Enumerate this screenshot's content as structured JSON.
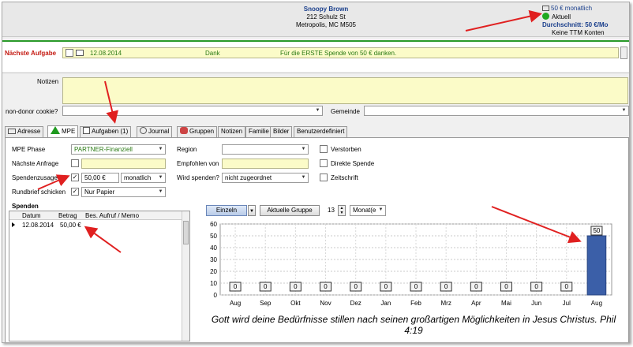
{
  "contact": {
    "name": "Snoopy Brown",
    "street": "212 Schulz St",
    "city": "Metropolis, MC  M505"
  },
  "status": {
    "monthly": "50 € monatlich",
    "current": "Aktuell",
    "average": "Durchschnitt: 50 €/Mo",
    "ttm": "Keine TTM Konten"
  },
  "task": {
    "label": "Nächste Aufgabe",
    "date": "12.08.2014",
    "type": "Dank",
    "description": "Für die ERSTE Spende von 50 € danken."
  },
  "notes_label": "Notizen",
  "cookie_label": "non-donor cookie?",
  "gemeinde_label": "Gemeinde",
  "tabs": [
    "Adresse",
    "MPE",
    "Aufgaben (1)",
    "Journal",
    "Gruppen",
    "Notizen",
    "Familie",
    "Bilder",
    "Benutzerdefiniert"
  ],
  "form": {
    "mpe_phase_label": "MPE Phase",
    "mpe_phase_value": "PARTNER-Finanziell",
    "next_request_label": "Nächste Anfrage",
    "pledge_label": "Spendenzusage",
    "pledge_amount": "50,00 €",
    "pledge_freq": "monatlich",
    "newsletter_label": "Rundbrief schicken",
    "newsletter_value": "Nur Papier",
    "region_label": "Region",
    "referred_label": "Empfohlen von",
    "will_give_label": "Wird spenden?",
    "will_give_value": "nicht zugeordnet",
    "deceased_label": "Verstorben",
    "direct_label": "Direkte Spende",
    "magazine_label": "Zeitschrift"
  },
  "gifts": {
    "title": "Spenden",
    "columns": [
      "Datum",
      "Betrag",
      "Bes. Aufruf / Memo"
    ],
    "rows": [
      {
        "date": "12.08.2014",
        "amount": "50,00 €"
      }
    ]
  },
  "chart_controls": {
    "single": "Einzeln",
    "group": "Aktuelle Gruppe",
    "count": "13",
    "period": "Monat(e"
  },
  "chart_data": {
    "type": "bar",
    "categories": [
      "Aug",
      "Sep",
      "Okt",
      "Nov",
      "Dez",
      "Jan",
      "Feb",
      "Mrz",
      "Apr",
      "Mai",
      "Jun",
      "Jul",
      "Aug"
    ],
    "values": [
      0,
      0,
      0,
      0,
      0,
      0,
      0,
      0,
      0,
      0,
      0,
      0,
      50
    ],
    "ylim": [
      0,
      60
    ],
    "yticks": [
      0,
      10,
      20,
      30,
      40,
      50,
      60
    ],
    "grid": true,
    "bar_color": "#3b5fa8"
  },
  "verse": "Gott wird deine Bedürfnisse stillen nach seinen großartigen Möglichkeiten in Jesus Christus.  Phil 4:19",
  "colors": {
    "accent_green": "#2a9a2a",
    "arrow_red": "#e02020"
  }
}
